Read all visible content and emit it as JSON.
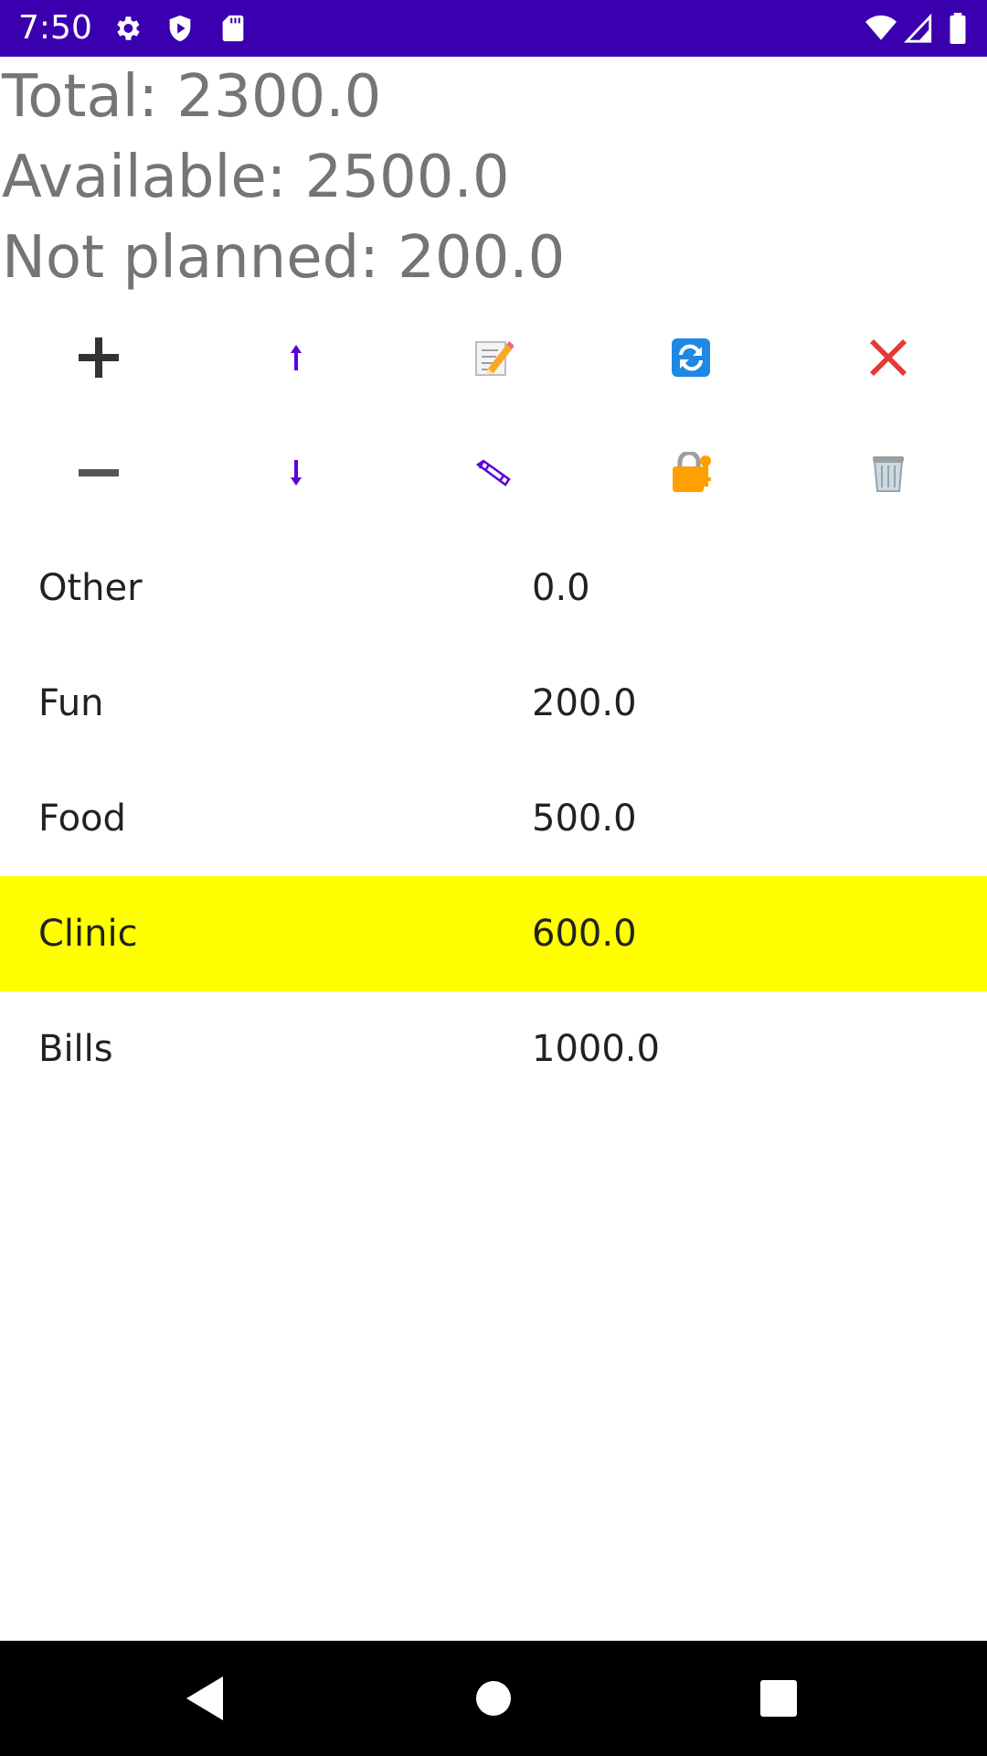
{
  "status_bar": {
    "time": "7:50",
    "left_icons": [
      "gear-icon",
      "shield-play-icon",
      "sd-card-icon"
    ],
    "right_icons": [
      "wifi-icon",
      "cell-signal-icon",
      "battery-icon"
    ],
    "background": "#3a00b0"
  },
  "summary": {
    "total": "Total: 2300.0",
    "available": "Available: 2500.0",
    "not_planned": "Not planned: 200.0"
  },
  "toolbar": {
    "row1": [
      "plus-icon",
      "arrow-up-icon",
      "memo-pencil-icon",
      "refresh-arrows-icon",
      "close-x-icon"
    ],
    "row2": [
      "minus-icon",
      "arrow-down-icon",
      "pencil-icon",
      "lock-key-icon",
      "trash-can-icon"
    ],
    "accent": "#5b00d6"
  },
  "items": [
    {
      "name": "Other",
      "value": "0.0"
    },
    {
      "name": "Fun",
      "value": "200.0"
    },
    {
      "name": "Food",
      "value": "500.0"
    },
    {
      "name": "Clinic",
      "value": "600.0"
    },
    {
      "name": "Bills",
      "value": "1000.0"
    }
  ],
  "selected_item": "Clinic",
  "selected_color": "#ffff00",
  "nav_bar": {
    "buttons": [
      "back-triangle-icon",
      "home-circle-icon",
      "recents-square-icon"
    ]
  }
}
